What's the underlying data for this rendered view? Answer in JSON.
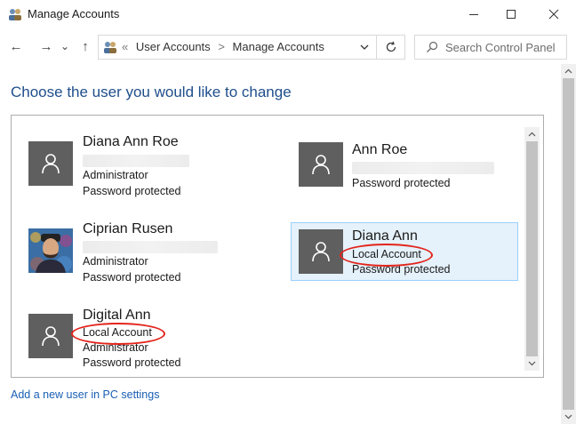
{
  "window": {
    "title": "Manage Accounts",
    "controls": [
      "minimize",
      "maximize",
      "close"
    ]
  },
  "navigation": {
    "back": "←",
    "forward": "→",
    "recent": "⌄",
    "up": "↑",
    "address_separator": "«",
    "breadcrumb": [
      "User Accounts",
      "Manage Accounts"
    ],
    "crumb_separator": ">",
    "search_placeholder": "Search Control Panel"
  },
  "main": {
    "heading": "Choose the user you would like to change",
    "add_user_link": "Add a new user in PC settings"
  },
  "accounts": [
    {
      "name": "Diana Ann Roe",
      "details": [
        "Administrator",
        "Password protected"
      ],
      "has_hidden_email": true,
      "avatar": "default-user",
      "selected": false
    },
    {
      "name": "Ann Roe",
      "details": [
        "Password protected"
      ],
      "has_hidden_email": true,
      "avatar": "default-user",
      "selected": false
    },
    {
      "name": "Ciprian Rusen",
      "details": [
        "Administrator",
        "Password protected"
      ],
      "has_hidden_email": true,
      "avatar": "photo",
      "selected": false
    },
    {
      "name": "Diana Ann",
      "details": [
        "Local Account",
        "Password protected"
      ],
      "has_hidden_email": false,
      "avatar": "default-user",
      "selected": true,
      "highlighted_detail": "Local Account"
    },
    {
      "name": "Digital Ann",
      "details": [
        "Local Account",
        "Administrator",
        "Password protected"
      ],
      "has_hidden_email": false,
      "avatar": "default-user",
      "selected": false,
      "highlighted_detail": "Local Account"
    }
  ],
  "colors": {
    "heading": "#1e4e8c",
    "link": "#1a5fb4",
    "selected_bg": "#e5f1fb",
    "selected_border": "#99d1ff",
    "highlight_ring": "#e3241b",
    "avatar_bg": "#5f5f5f"
  }
}
